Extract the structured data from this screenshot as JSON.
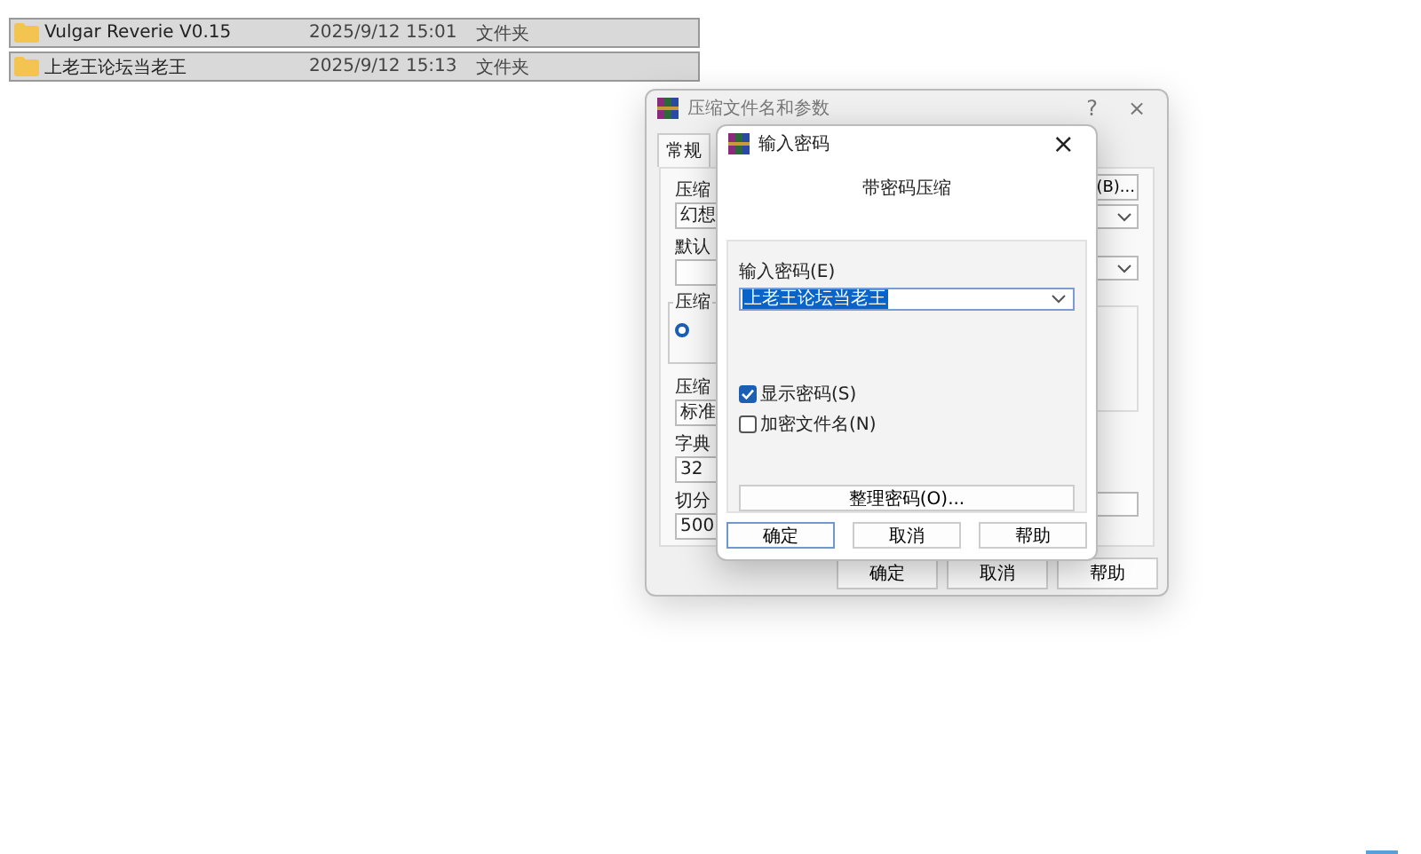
{
  "file_list": {
    "rows": [
      {
        "name": "Vulgar Reverie V0.15",
        "modified": "2025/9/12 15:01",
        "type": "文件夹",
        "selected": true
      },
      {
        "name": "上老王论坛当老王",
        "modified": "2025/9/12 15:13",
        "type": "文件夹",
        "selected": true
      }
    ]
  },
  "archive_dialog": {
    "title": "压缩文件名和参数",
    "help_button": "?",
    "close_button": "×",
    "tabs": [
      {
        "label": "常规",
        "selected": true
      }
    ],
    "archive_name_label": "压缩",
    "archive_name_value": "幻想",
    "browse_button": "(B)...",
    "profile_label": "默认",
    "format_group_label": "压缩",
    "format_radio_selected": true,
    "method_label": "压缩",
    "method_value": "标准",
    "dictionary_label": "字典",
    "dictionary_value": "32",
    "split_label": "切分",
    "split_value": "500",
    "buttons": [
      "确定",
      "取消",
      "帮助"
    ]
  },
  "password_dialog": {
    "title": "输入密码",
    "close_button": "×",
    "heading": "带密码压缩",
    "password_label": "输入密码(E)",
    "password_value": "上老王论坛当老王",
    "password_selected": true,
    "options": [
      {
        "label": "显示密码(S)",
        "checked": true
      },
      {
        "label": "加密文件名(N)",
        "checked": false
      }
    ],
    "organize_button": "整理密码(O)...",
    "buttons": [
      {
        "label": "确定",
        "default": true
      },
      {
        "label": "取消",
        "default": false
      },
      {
        "label": "帮助",
        "default": false
      }
    ]
  }
}
